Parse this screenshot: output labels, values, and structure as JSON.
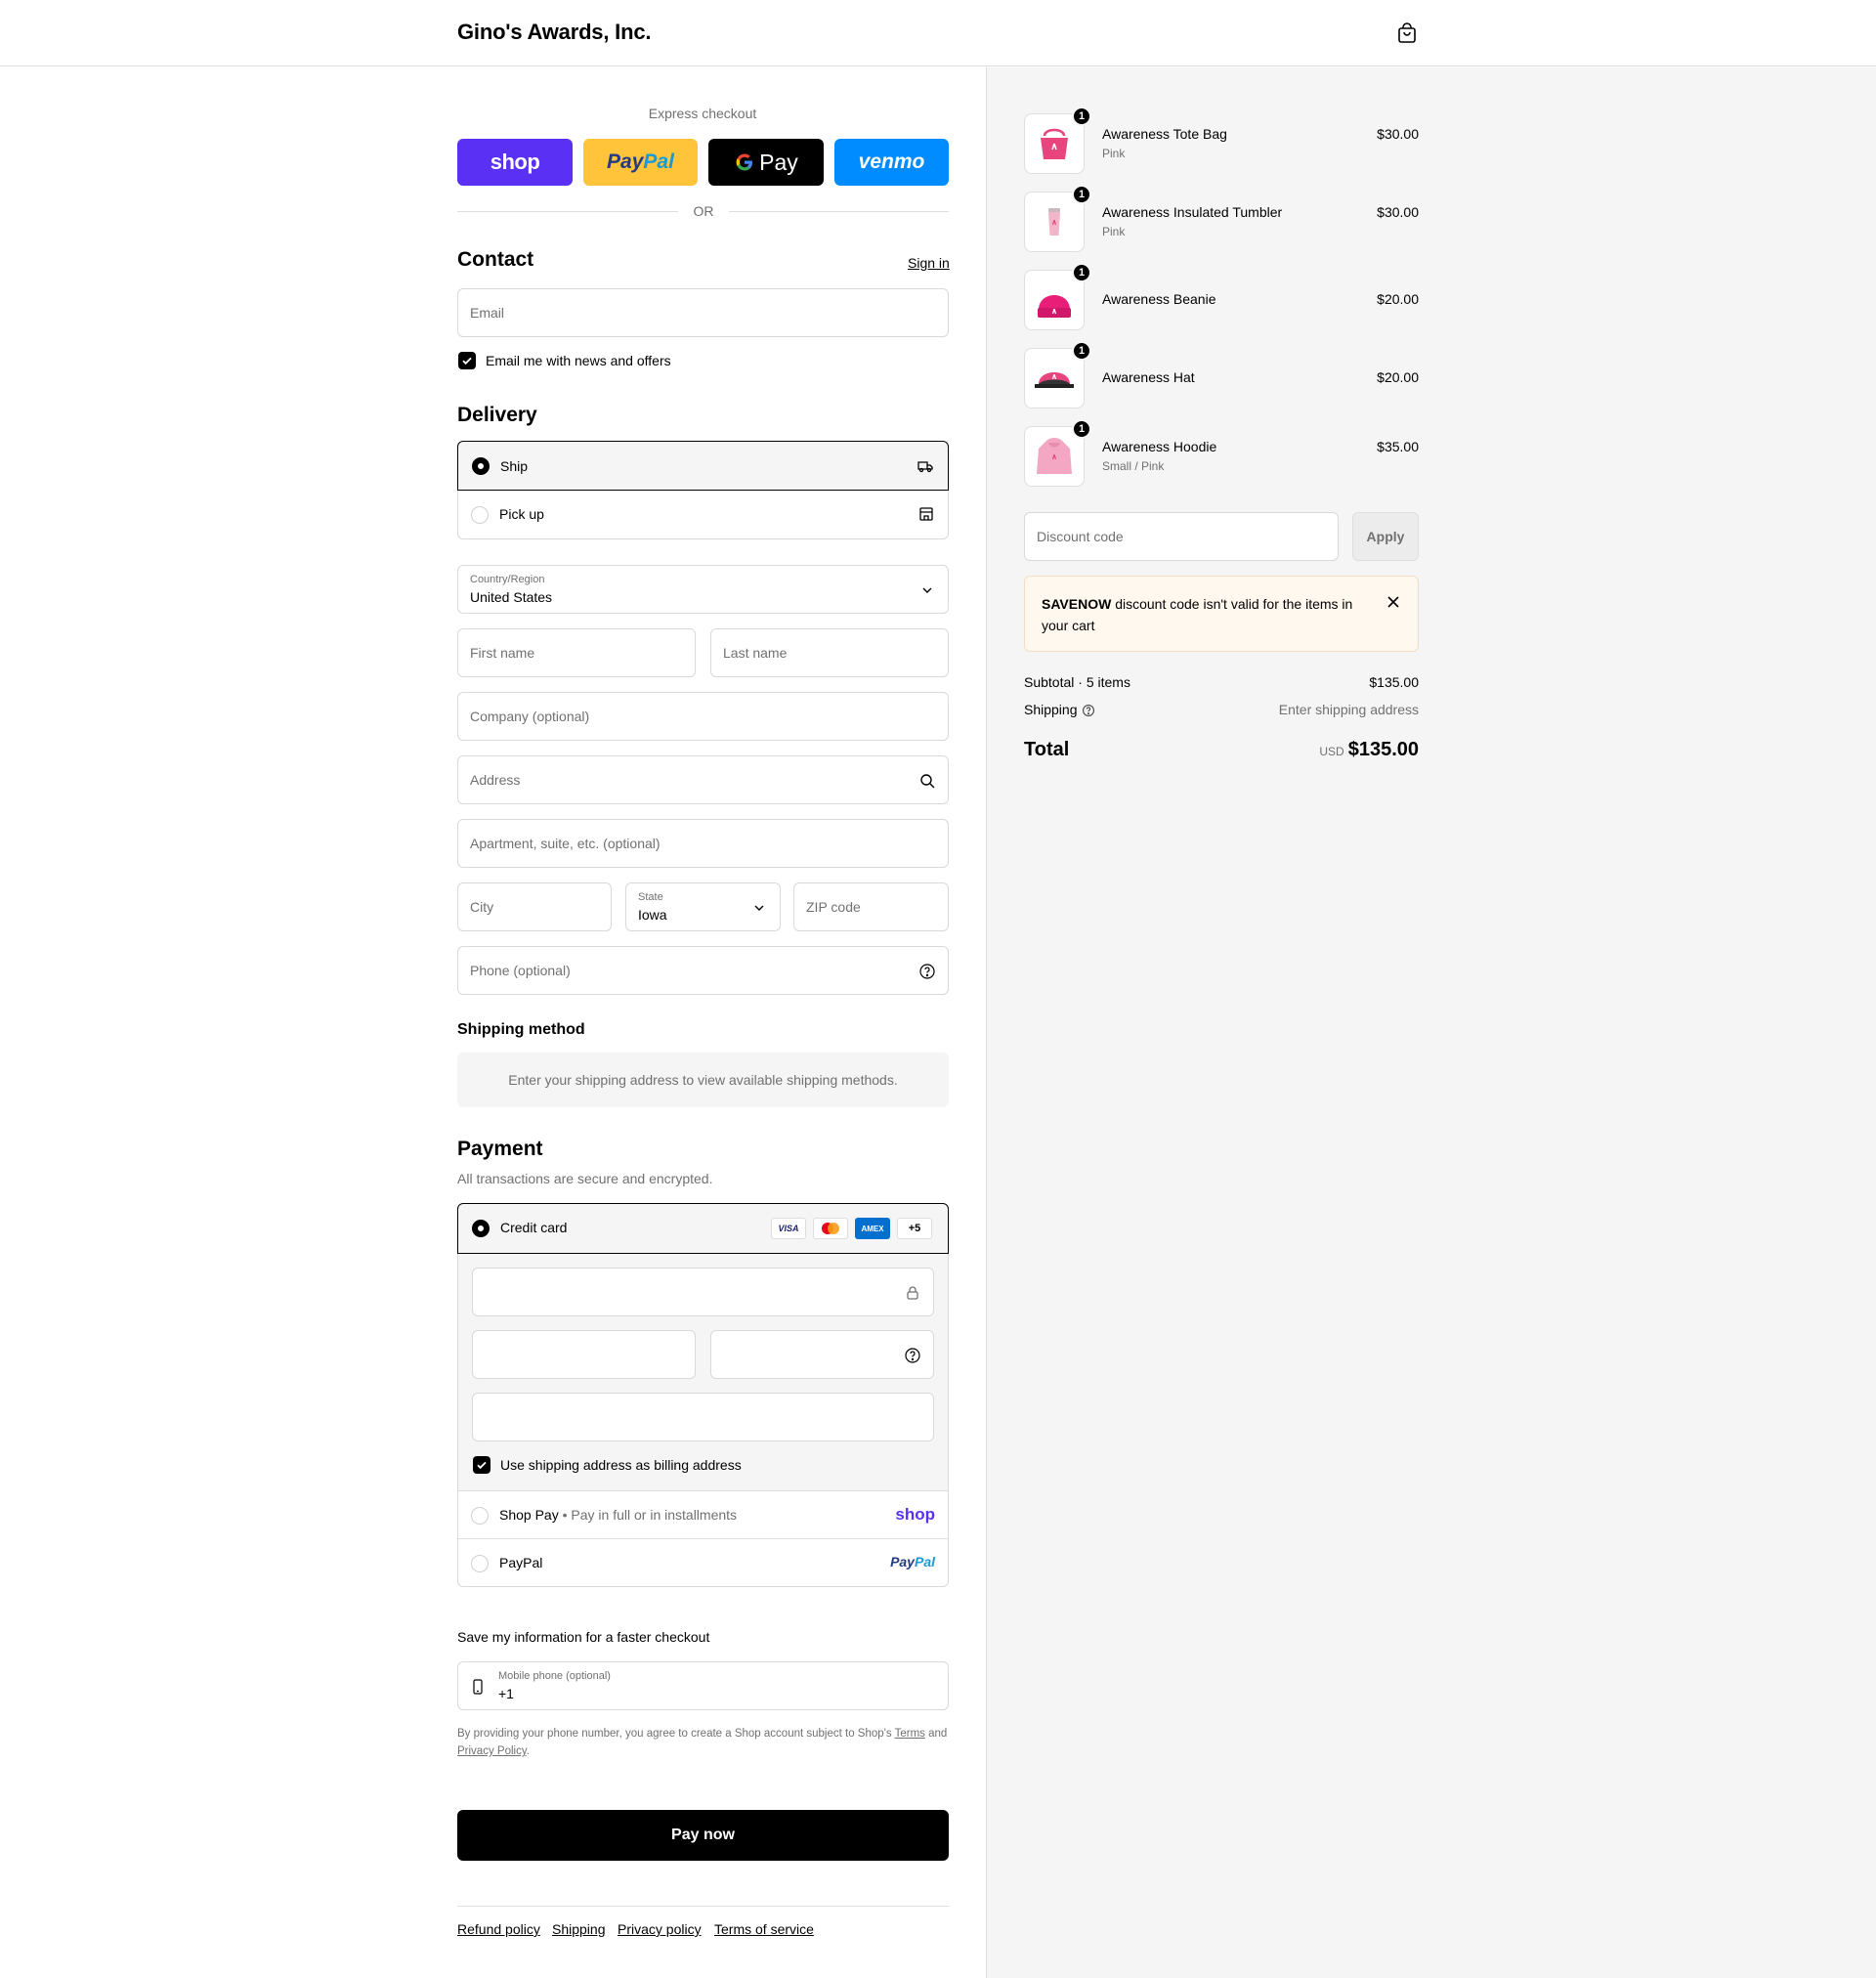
{
  "header": {
    "store_name": "Gino's Awards, Inc."
  },
  "express": {
    "title": "Express checkout",
    "buttons": {
      "shop": "shop",
      "paypal_pay": "Pay",
      "paypal_pal": "Pal",
      "gpay": "Pay",
      "venmo": "venmo"
    },
    "or_label": "OR"
  },
  "contact": {
    "title": "Contact",
    "sign_in": "Sign in",
    "email_placeholder": "Email",
    "news_label": "Email me with news and offers",
    "news_checked": true
  },
  "delivery": {
    "title": "Delivery",
    "options": [
      {
        "label": "Ship",
        "selected": true
      },
      {
        "label": "Pick up",
        "selected": false
      }
    ],
    "country_label": "Country/Region",
    "country_value": "United States",
    "first_name": "First name",
    "last_name": "Last name",
    "company": "Company (optional)",
    "address": "Address",
    "apartment": "Apartment, suite, etc. (optional)",
    "city": "City",
    "state_label": "State",
    "state_value": "Iowa",
    "zip": "ZIP code",
    "phone": "Phone (optional)"
  },
  "shipping_method": {
    "title": "Shipping method",
    "message": "Enter your shipping address to view available shipping methods."
  },
  "payment": {
    "title": "Payment",
    "subtitle": "All transactions are secure and encrypted.",
    "credit_card_label": "Credit card",
    "card_logos": {
      "visa": "VISA",
      "amex": "AMEX",
      "more": "+5"
    },
    "billing_label": "Use shipping address as billing address",
    "billing_checked": true,
    "shop_pay_label": "Shop Pay",
    "shop_pay_sep": "•",
    "shop_pay_desc": "Pay in full or in installments",
    "shop_pay_logo": "shop",
    "paypal_label": "PayPal",
    "paypal_logo_pay": "Pay",
    "paypal_logo_pal": "Pal"
  },
  "save_info": {
    "title": "Save my information for a faster checkout",
    "phone_label": "Mobile phone (optional)",
    "phone_value": "+1",
    "terms_prefix": "By providing your phone number, you agree to create a Shop account subject to Shop's",
    "terms_link": "Terms",
    "terms_and": "and",
    "privacy_link": "Privacy Policy",
    "terms_end": "."
  },
  "pay_now": "Pay now",
  "footer": {
    "links": [
      "Refund policy",
      "Shipping",
      "Privacy policy",
      "Terms of service"
    ]
  },
  "summary": {
    "items": [
      {
        "name": "Awareness Tote Bag",
        "variant": "Pink",
        "price": "$30.00",
        "qty": "1",
        "icon": "tote-bag-icon"
      },
      {
        "name": "Awareness Insulated Tumbler",
        "variant": "Pink",
        "price": "$30.00",
        "qty": "1",
        "icon": "tumbler-icon"
      },
      {
        "name": "Awareness Beanie",
        "variant": "",
        "price": "$20.00",
        "qty": "1",
        "icon": "beanie-icon"
      },
      {
        "name": "Awareness Hat",
        "variant": "",
        "price": "$20.00",
        "qty": "1",
        "icon": "hat-icon"
      },
      {
        "name": "Awareness Hoodie",
        "variant": "Small / Pink",
        "price": "$35.00",
        "qty": "1",
        "icon": "hoodie-icon"
      }
    ],
    "discount_placeholder": "Discount code",
    "apply_label": "Apply",
    "error_code": "SAVENOW",
    "error_message": "discount code isn't valid for the items in your cart",
    "subtotal_label": "Subtotal · 5 items",
    "subtotal_value": "$135.00",
    "shipping_label": "Shipping",
    "shipping_value": "Enter shipping address",
    "total_label": "Total",
    "currency": "USD",
    "total_value": "$135.00"
  },
  "colors": {
    "shop_purple": "#5a31f4",
    "paypal_yellow": "#ffc439",
    "venmo_blue": "#008cff",
    "pink": "#e8457f",
    "error_bg": "#fff8ef"
  }
}
